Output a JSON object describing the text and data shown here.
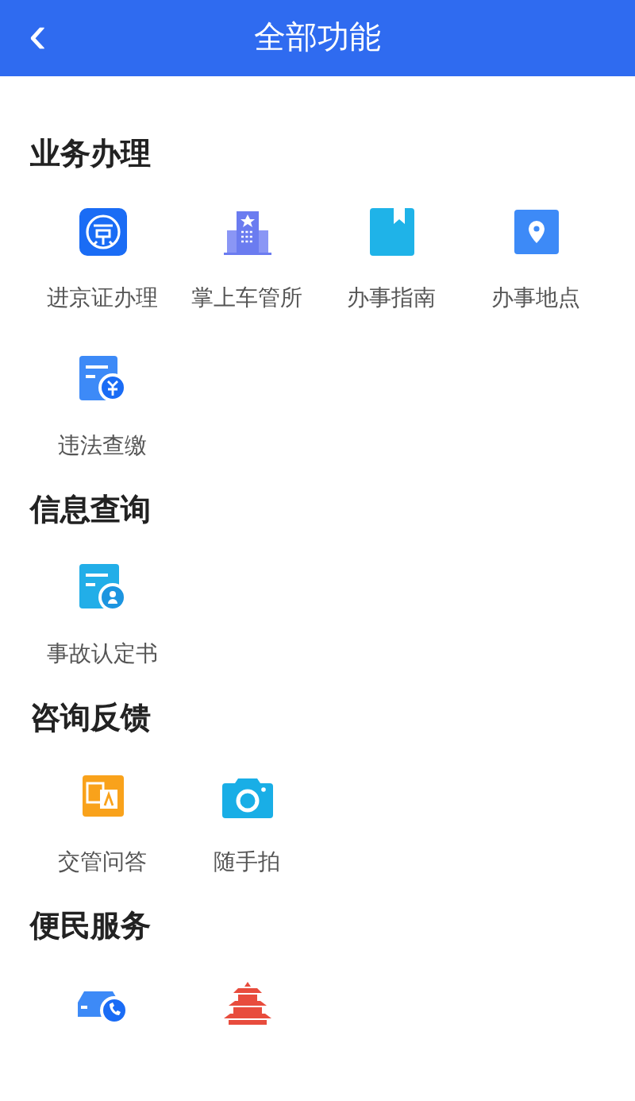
{
  "header": {
    "back": "‹",
    "title": "全部功能"
  },
  "sections": [
    {
      "title": "业务办理",
      "items": [
        {
          "kind": "jing",
          "label": "进京证办理"
        },
        {
          "kind": "bldg",
          "label": "掌上车管所"
        },
        {
          "kind": "book",
          "label": "办事指南"
        },
        {
          "kind": "pin",
          "label": "办事地点"
        },
        {
          "kind": "fine",
          "label": "违法查缴"
        }
      ]
    },
    {
      "title": "信息查询",
      "items": [
        {
          "kind": "doc",
          "label": "事故认定书"
        }
      ]
    },
    {
      "title": "咨询反馈",
      "items": [
        {
          "kind": "qa",
          "label": "交管问答"
        },
        {
          "kind": "cam",
          "label": "随手拍"
        }
      ]
    },
    {
      "title": "便民服务",
      "items": [
        {
          "kind": "car"
        },
        {
          "kind": "tower"
        }
      ]
    }
  ]
}
